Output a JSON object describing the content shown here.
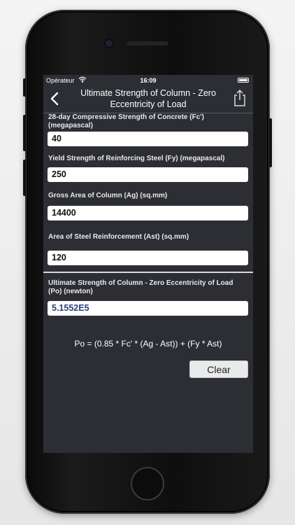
{
  "status_bar": {
    "carrier": "Opérateur",
    "time": "16:09"
  },
  "nav": {
    "title": "Ultimate Strength of Column  - Zero Eccentricity of Load"
  },
  "inputs": [
    {
      "label": "28-day Compressive Strength of Concrete (Fc') (megapascal)",
      "value": "40"
    },
    {
      "label": "Yield Strength of Reinforcing Steel (Fy) (megapascal)",
      "value": "250"
    },
    {
      "label": "Gross Area of Column (Ag) (sq.mm)",
      "value": "14400"
    },
    {
      "label": "Area of Steel Reinforcement (Ast) (sq.mm)",
      "value": "120"
    }
  ],
  "result": {
    "label": "Ultimate Strength of Column - Zero Eccentricity of Load (Po) (newton)",
    "value": "5.1552E5"
  },
  "formula": "Po = (0.85 * Fc' * (Ag - Ast)) + (Fy * Ast)",
  "clear_label": "Clear",
  "icons": [
    "back-chevron-icon",
    "share-icon",
    "wifi-icon",
    "battery-icon"
  ]
}
